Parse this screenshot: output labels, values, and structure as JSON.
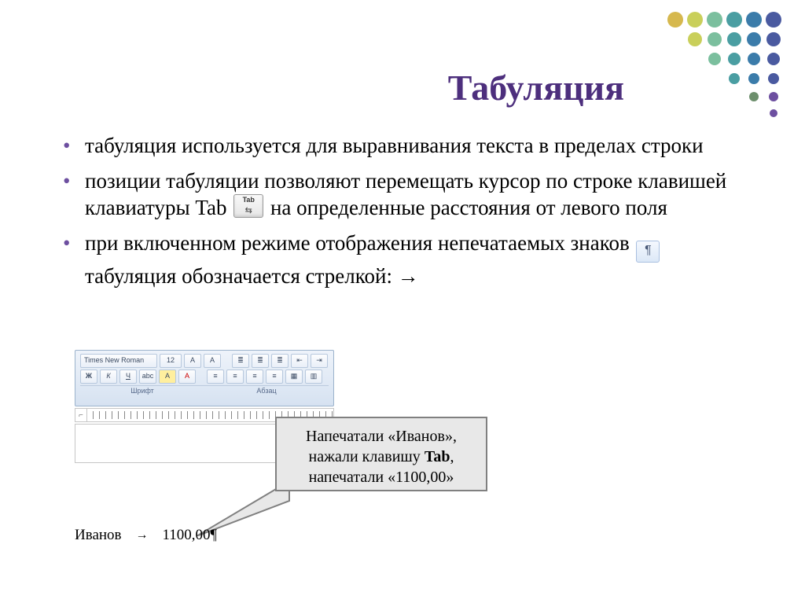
{
  "title": "Табуляция",
  "bullets": {
    "b1": "табуляция используется для выравнивания текста в пределах строки",
    "b2a": "позиции табуляции позволяют перемещать курсор по строке клавишей клавиатуры Tab ",
    "b2b": " на определенные расстояния от левого поля",
    "b3a": "при включенном режиме отображения непечатаемых знаков ",
    "b3b": " табуляция обозначается стрелкой: →"
  },
  "tab_key_label": "Tab",
  "pilcrow_symbol": "¶",
  "ribbon": {
    "font_name": "Times New Roman",
    "font_size": "12",
    "group_font": "Шрифт",
    "group_para": "Абзац"
  },
  "callout": {
    "line1": "Напечатали «Иванов»,",
    "line2_a": "нажали клавишу ",
    "line2_b": "Tab",
    "line2_c": ",",
    "line3": "напечатали «1100,00»"
  },
  "example": {
    "word1": "Иванов",
    "word2": "1100,00¶"
  }
}
